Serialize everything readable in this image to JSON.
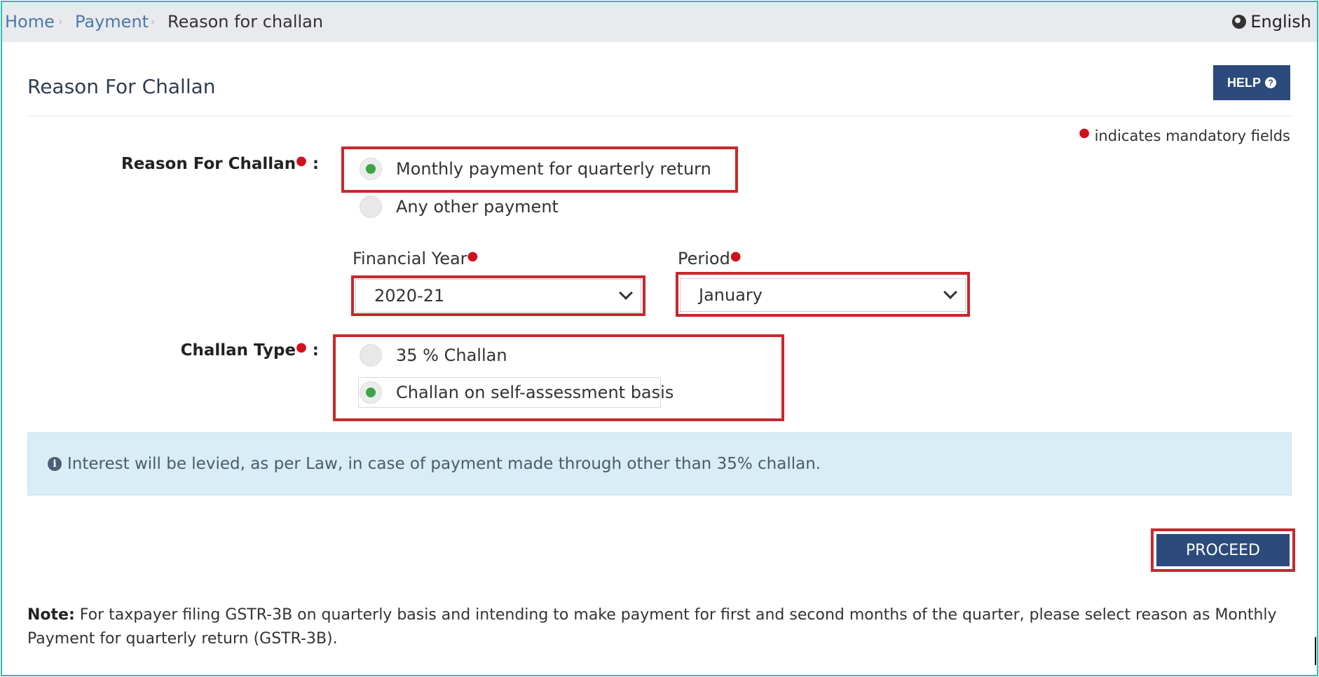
{
  "breadcrumb": {
    "items": [
      "Home",
      "Payment"
    ],
    "current": "Reason for challan",
    "separator": "›"
  },
  "language": "English",
  "page_title": "Reason For Challan",
  "help_label": "HELP",
  "mandatory_note": "indicates mandatory fields",
  "reason": {
    "label": "Reason For Challan",
    "colon": ":",
    "options": [
      "Monthly payment for quarterly return",
      "Any other payment"
    ],
    "selected": "Monthly payment for quarterly return"
  },
  "financial_year": {
    "label": "Financial Year",
    "value": "2020-21"
  },
  "period": {
    "label": "Period",
    "value": "January"
  },
  "challan_type": {
    "label": "Challan Type",
    "colon": ":",
    "options": [
      "35 % Challan",
      "Challan on self-assessment basis"
    ],
    "selected": "Challan on self-assessment basis"
  },
  "info": "Interest will be levied, as per Law, in case of payment made through other than 35% challan.",
  "proceed_label": "PROCEED",
  "note": {
    "prefix": "Note:",
    "text": "For taxpayer filing GSTR-3B on quarterly basis and intending to make payment for first and second months of the quarter, please select reason as Monthly Payment for quarterly return (GSTR-3B)."
  },
  "colors": {
    "accent": "#2c4a7c",
    "highlight": "#c8282d",
    "radio_selected": "#3ca444",
    "info_bg": "#d9edf7",
    "frame": "#35b7b0"
  }
}
